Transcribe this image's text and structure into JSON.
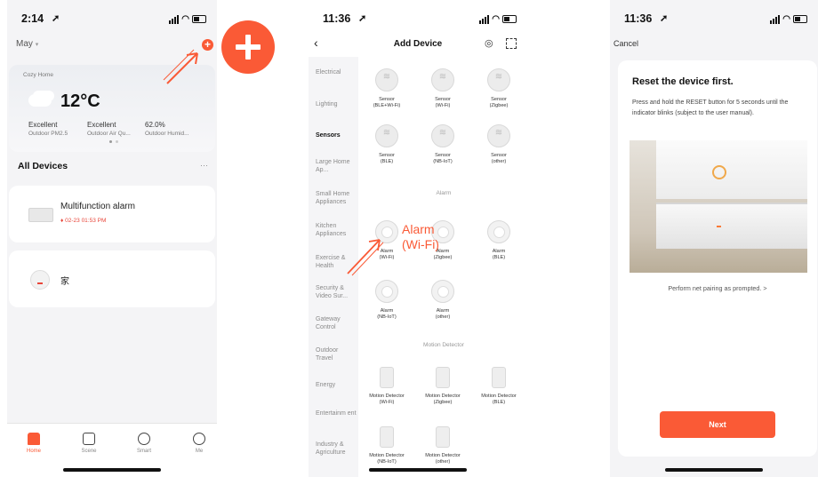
{
  "colors": {
    "accent": "#fa5a36",
    "bg": "#f4f4f6"
  },
  "screen1": {
    "time": "2:14",
    "home_selector": "May",
    "weather": {
      "home_name": "Cozy Home",
      "temperature": "12°C",
      "metrics": [
        {
          "value": "Excellent",
          "label": "Outdoor PM2.5"
        },
        {
          "value": "Excellent",
          "label": "Outdoor Air Qu..."
        },
        {
          "value": "62.0%",
          "label": "Outdoor Humid..."
        }
      ]
    },
    "section_title": "All Devices",
    "more_label": "···",
    "devices": [
      {
        "name": "Multifunction alarm",
        "status": "02-23 01:53 PM"
      },
      {
        "name": "家"
      }
    ],
    "tabs": [
      {
        "label": "Home",
        "icon": "home-icon"
      },
      {
        "label": "Scene",
        "icon": "scene-icon"
      },
      {
        "label": "Smart",
        "icon": "smart-icon"
      },
      {
        "label": "Me",
        "icon": "me-icon"
      }
    ]
  },
  "screen2": {
    "time": "11:36",
    "title": "Add Device",
    "categories": [
      "Electrical",
      "Lighting",
      "Sensors",
      "Large Home Ap...",
      "Small Home Appliances",
      "Kitchen Appliances",
      "Exercise & Health",
      "Security & Video Sur...",
      "Gateway Control",
      "Outdoor Travel",
      "Energy",
      "Entertainm ent",
      "Industry & Agriculture"
    ],
    "sensors": [
      {
        "name": "Sensor",
        "sub": "(BLE+Wi-Fi)"
      },
      {
        "name": "Sensor",
        "sub": "(Wi-Fi)"
      },
      {
        "name": "Sensor",
        "sub": "(Zigbee)"
      },
      {
        "name": "Sensor",
        "sub": "(BLE)"
      },
      {
        "name": "Sensor",
        "sub": "(NB-IoT)"
      },
      {
        "name": "Sensor",
        "sub": "(other)"
      }
    ],
    "alarm_header": "Alarm",
    "alarms": [
      {
        "name": "Alarm",
        "sub": "(Wi-Fi)"
      },
      {
        "name": "Alarm",
        "sub": "(Zigbee)"
      },
      {
        "name": "Alarm",
        "sub": "(BLE)"
      },
      {
        "name": "Alarm",
        "sub": "(NB-IoT)"
      },
      {
        "name": "Alarm",
        "sub": "(other)"
      }
    ],
    "motion_header": "Motion Detector",
    "motions": [
      {
        "name": "Motion Detector",
        "sub": "(Wi-Fi)"
      },
      {
        "name": "Motion Detector",
        "sub": "(Zigbee)"
      },
      {
        "name": "Motion Detector",
        "sub": "(BLE)"
      },
      {
        "name": "Motion Detector",
        "sub": "(NB-IoT)"
      },
      {
        "name": "Motion Detector",
        "sub": "(other)"
      }
    ],
    "callout_line1": "Alarm",
    "callout_line2": "(Wi-Fi)"
  },
  "screen3": {
    "time": "11:36",
    "cancel": "Cancel",
    "heading": "Reset the device first.",
    "instructions": "Press and hold the RESET button for 5 seconds until the indicator blinks (subject to the user manual).",
    "prompt_link": "Perform net pairing as prompted. >",
    "next": "Next"
  }
}
